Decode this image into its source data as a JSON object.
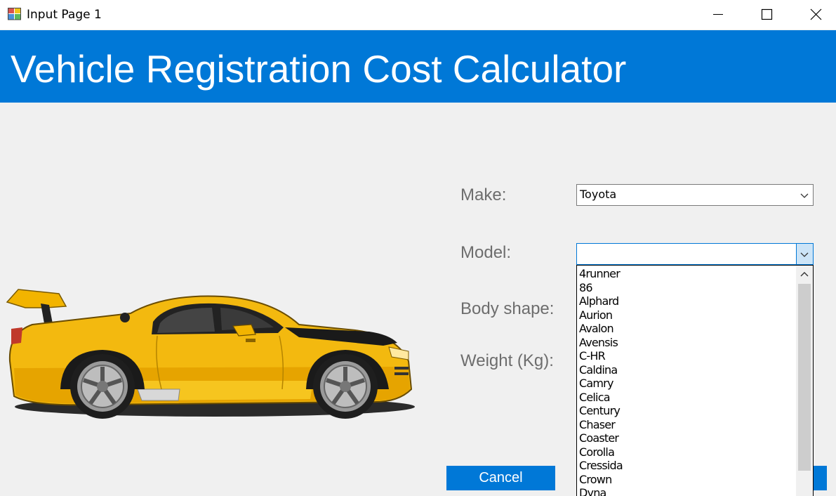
{
  "window": {
    "title": "Input Page 1",
    "controls": [
      "minimize-icon",
      "maximize-icon",
      "close-icon"
    ]
  },
  "header": {
    "title": "Vehicle Registration Cost Calculator",
    "color": "#0078d7"
  },
  "form": {
    "make_label": "Make:",
    "make_value": "Toyota",
    "model_label": "Model:",
    "model_value": "",
    "body_shape_label": "Body shape:",
    "weight_label": "Weight (Kg):"
  },
  "model_dropdown": {
    "options": [
      "4runner",
      "86",
      "Alphard",
      "Aurion",
      "Avalon",
      "Avensis",
      "C-HR",
      "Caldina",
      "Camry",
      "Celica",
      "Century",
      "Chaser",
      "Coaster",
      "Corolla",
      "Cressida",
      "Crown",
      "Dyna"
    ]
  },
  "buttons": {
    "cancel": "Cancel"
  },
  "image": {
    "icon": "sports-car-illustration"
  }
}
